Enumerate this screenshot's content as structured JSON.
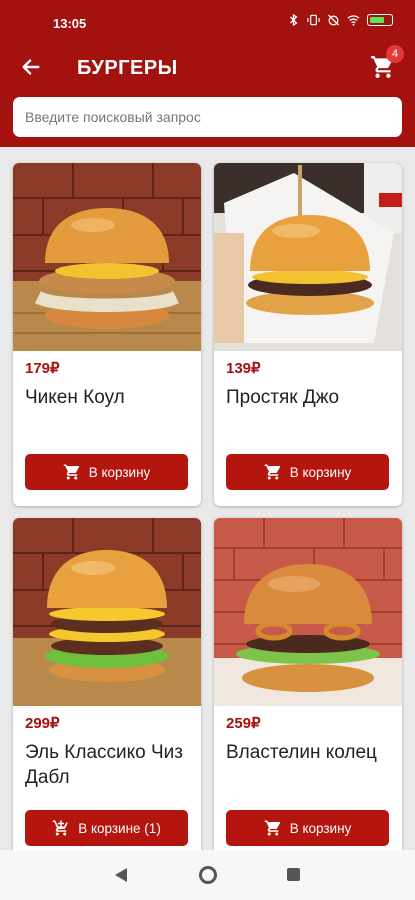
{
  "status": {
    "time": "13:05",
    "battery": "68"
  },
  "header": {
    "title": "БУРГЕРЫ",
    "cart_count": "4"
  },
  "search": {
    "placeholder": "Введите поисковый запрос",
    "value": ""
  },
  "products": [
    {
      "price": "179₽",
      "name": "Чикен Коул",
      "button": "В корзину"
    },
    {
      "price": "139₽",
      "name": "Простяк Джо",
      "button": "В корзину"
    },
    {
      "price": "299₽",
      "name": "Эль Классико Чиз Дабл",
      "button": "В корзине (1)"
    },
    {
      "price": "259₽",
      "name": "Властелин колец",
      "button": "В корзину"
    }
  ],
  "colors": {
    "brand": "#a3120f",
    "button": "#b5150f",
    "badge": "#e53935"
  }
}
